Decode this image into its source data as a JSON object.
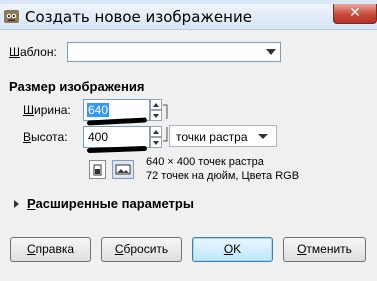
{
  "window": {
    "title": "Создать новое изображение",
    "close_glyph": "✕"
  },
  "template": {
    "label_accel": "Ш",
    "label_rest": "аблон:",
    "value": ""
  },
  "image_size": {
    "section_title": "Размер изображения",
    "width": {
      "label_accel": "Ш",
      "label_rest": "ирина:",
      "value": "640"
    },
    "height": {
      "label_accel": "В",
      "label_rest": "ысота:",
      "value": "400"
    },
    "units": "точки растра",
    "info_line1": "640 × 400 точек растра",
    "info_line2": "72 точек на дюйм, Цвета RGB"
  },
  "advanced": {
    "label_accel": "Р",
    "label_rest": "асширенные параметры"
  },
  "buttons": {
    "help": {
      "accel": "С",
      "rest": "правка"
    },
    "reset": {
      "accel": "С",
      "rest": "бросить"
    },
    "ok": {
      "accel": "О",
      "rest": "K"
    },
    "cancel": {
      "accel": "О",
      "rest": "тменить"
    }
  },
  "colors": {
    "selection": "#3399ff",
    "close_button": "#c8493a",
    "default_button": "#bee6fd"
  },
  "icons": [
    "gimp-app-icon",
    "close-icon",
    "chevron-down-icon",
    "spin-up-icon",
    "spin-down-icon",
    "chain-link-icon",
    "portrait-icon",
    "landscape-icon",
    "expander-arrow-icon"
  ]
}
